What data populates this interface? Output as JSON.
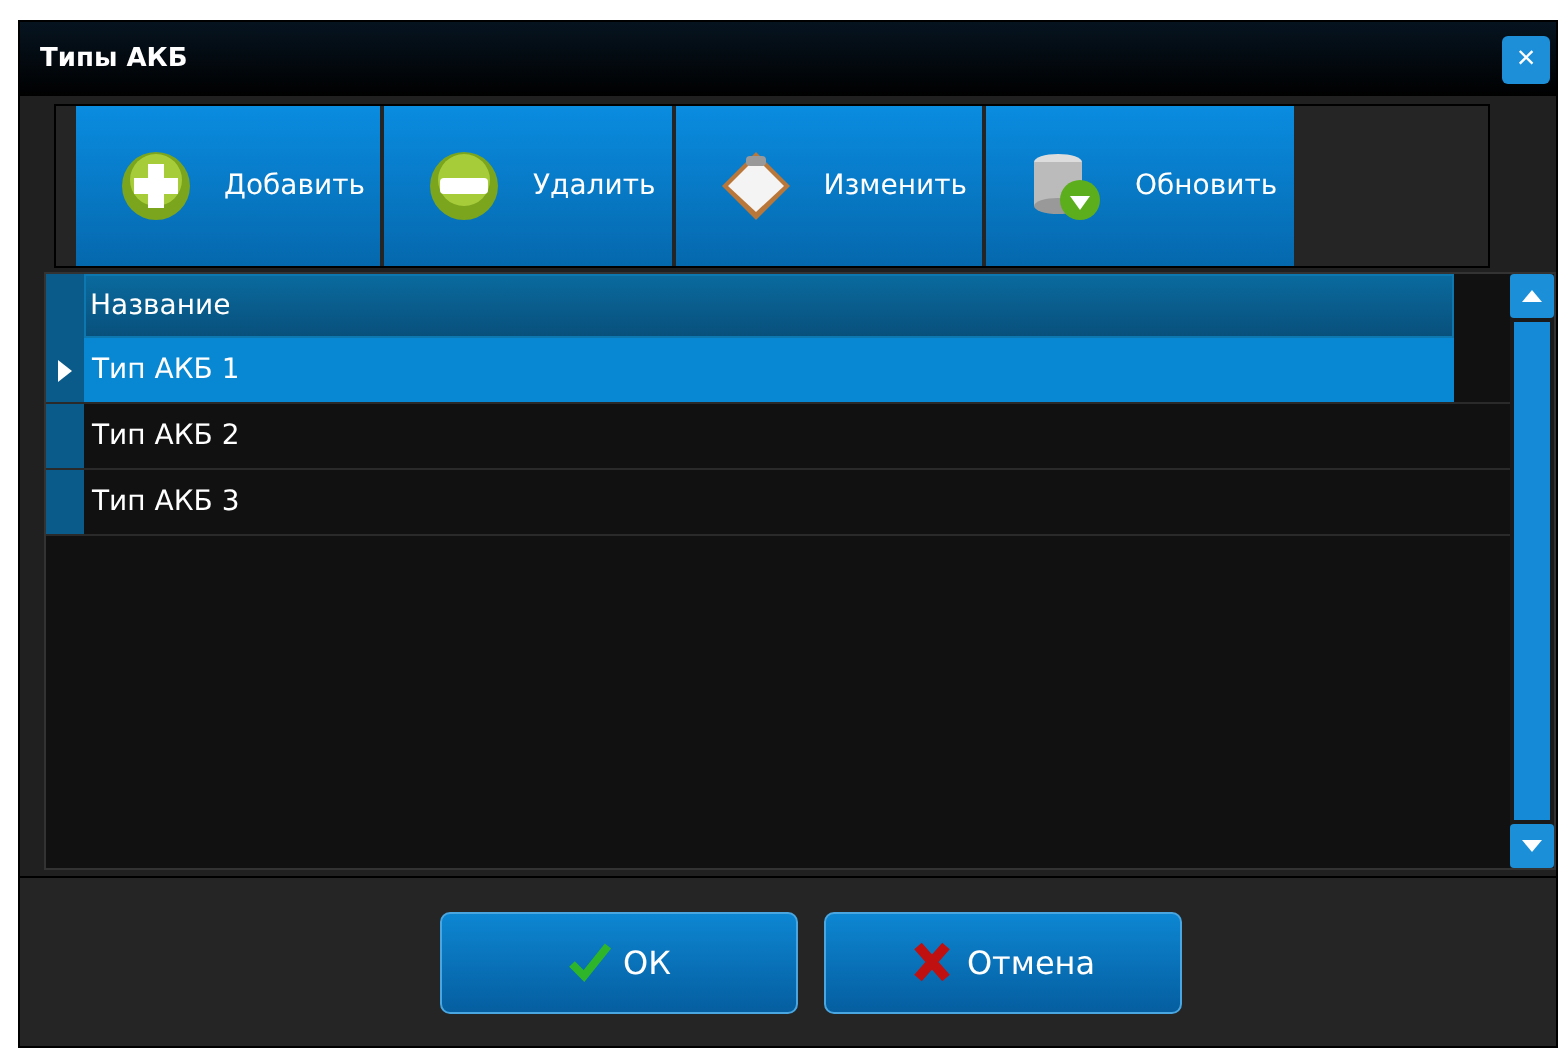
{
  "window": {
    "title": "Типы АКБ",
    "close": "×"
  },
  "toolbar": [
    {
      "kind": "add",
      "label": "Добавить"
    },
    {
      "kind": "remove",
      "label": "Удалить"
    },
    {
      "kind": "edit",
      "label": "Изменить"
    },
    {
      "kind": "refresh",
      "label": "Обновить"
    }
  ],
  "table": {
    "columns": [
      "Название"
    ],
    "rows": [
      {
        "cells": [
          "Тип АКБ 1"
        ],
        "selected": true
      },
      {
        "cells": [
          "Тип АКБ 2"
        ],
        "selected": false
      },
      {
        "cells": [
          "Тип АКБ 3"
        ],
        "selected": false
      }
    ]
  },
  "buttons": [
    {
      "kind": "ok",
      "label": "ОК"
    },
    {
      "kind": "cancel",
      "label": "Отмена"
    }
  ]
}
